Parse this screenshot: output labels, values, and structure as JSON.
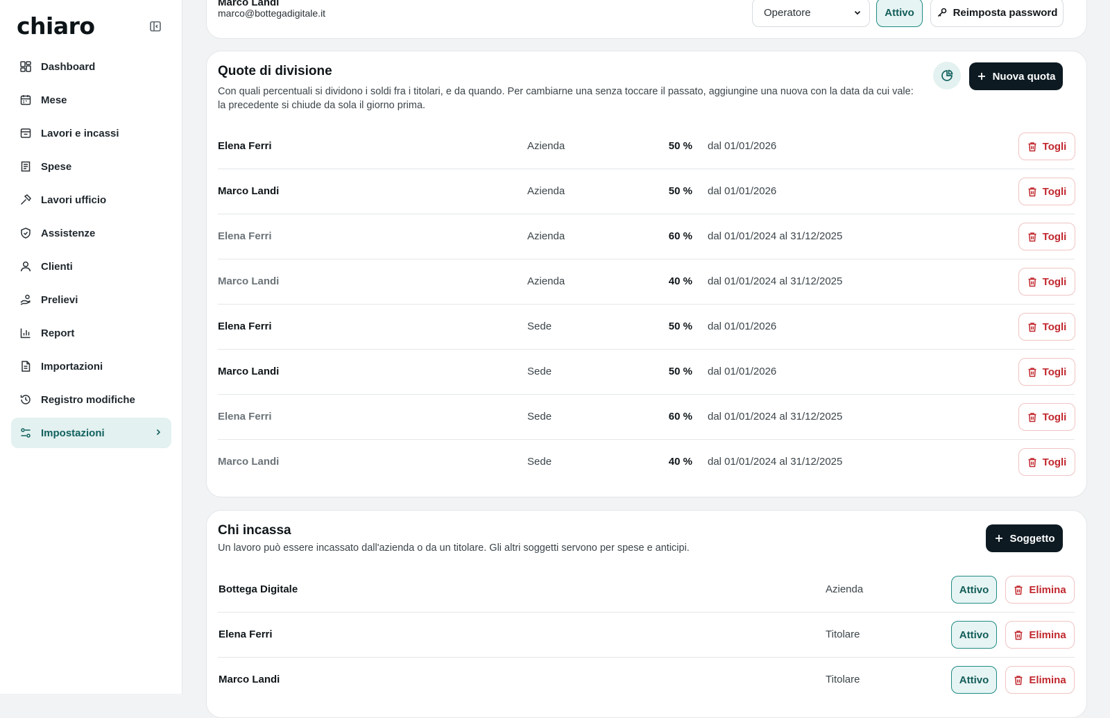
{
  "sidebar": {
    "brand": "chiaro",
    "items": [
      {
        "label": "Dashboard",
        "icon": "dashboard-icon"
      },
      {
        "label": "Mese",
        "icon": "calendar-icon"
      },
      {
        "label": "Lavori e incassi",
        "icon": "inbox-icon"
      },
      {
        "label": "Spese",
        "icon": "receipt-icon"
      },
      {
        "label": "Lavori ufficio",
        "icon": "hammer-icon"
      },
      {
        "label": "Assistenze",
        "icon": "shield-icon"
      },
      {
        "label": "Clienti",
        "icon": "user-icon"
      },
      {
        "label": "Prelievi",
        "icon": "hand-coins-icon"
      },
      {
        "label": "Report",
        "icon": "bar-chart-icon"
      },
      {
        "label": "Importazioni",
        "icon": "file-import-icon"
      },
      {
        "label": "Registro modifiche",
        "icon": "history-icon"
      },
      {
        "label": "Impostazioni",
        "icon": "settings-sliders-icon",
        "active": true
      }
    ]
  },
  "user_card": {
    "name": "Marco Landi",
    "email": "marco@bottegadigitale.it",
    "role": "Operatore",
    "status": "Attivo",
    "reset_label": "Reimposta password"
  },
  "quote": {
    "title": "Quote di divisione",
    "description_line1": "Con quali percentuali si dividono i soldi fra i titolari, e da quando. Per cambiarne una senza toccare il passato, aggiungine una nuova con la data da cui vale:",
    "description_line2": "la precedente si chiude da sola il giorno prima.",
    "new_label": "Nuova quota",
    "remove_label": "Togli",
    "rows": [
      {
        "name": "Elena Ferri",
        "scope": "Azienda",
        "percent": "50 %",
        "period": "dal 01/01/2026",
        "past": false
      },
      {
        "name": "Marco Landi",
        "scope": "Azienda",
        "percent": "50 %",
        "period": "dal 01/01/2026",
        "past": false
      },
      {
        "name": "Elena Ferri",
        "scope": "Azienda",
        "percent": "60 %",
        "period": "dal 01/01/2024 al 31/12/2025",
        "past": true
      },
      {
        "name": "Marco Landi",
        "scope": "Azienda",
        "percent": "40 %",
        "period": "dal 01/01/2024 al 31/12/2025",
        "past": true
      },
      {
        "name": "Elena Ferri",
        "scope": "Sede",
        "percent": "50 %",
        "period": "dal 01/01/2026",
        "past": false
      },
      {
        "name": "Marco Landi",
        "scope": "Sede",
        "percent": "50 %",
        "period": "dal 01/01/2026",
        "past": false
      },
      {
        "name": "Elena Ferri",
        "scope": "Sede",
        "percent": "60 %",
        "period": "dal 01/01/2024 al 31/12/2025",
        "past": true
      },
      {
        "name": "Marco Landi",
        "scope": "Sede",
        "percent": "40 %",
        "period": "dal 01/01/2024 al 31/12/2025",
        "past": true
      }
    ]
  },
  "chi_incassa": {
    "title": "Chi incassa",
    "description": "Un lavoro può essere incassato dall'azienda o da un titolare. Gli altri soggetti servono per spese e anticipi.",
    "new_label": "Soggetto",
    "active_label": "Attivo",
    "delete_label": "Elimina",
    "rows": [
      {
        "name": "Bottega Digitale",
        "type": "Azienda"
      },
      {
        "name": "Elena Ferri",
        "type": "Titolare"
      },
      {
        "name": "Marco Landi",
        "type": "Titolare"
      }
    ]
  },
  "colors": {
    "accent": "#11615e",
    "accent_bg": "#e3f1f0",
    "danger": "#c0272d",
    "dark_button": "#0d1a22"
  }
}
